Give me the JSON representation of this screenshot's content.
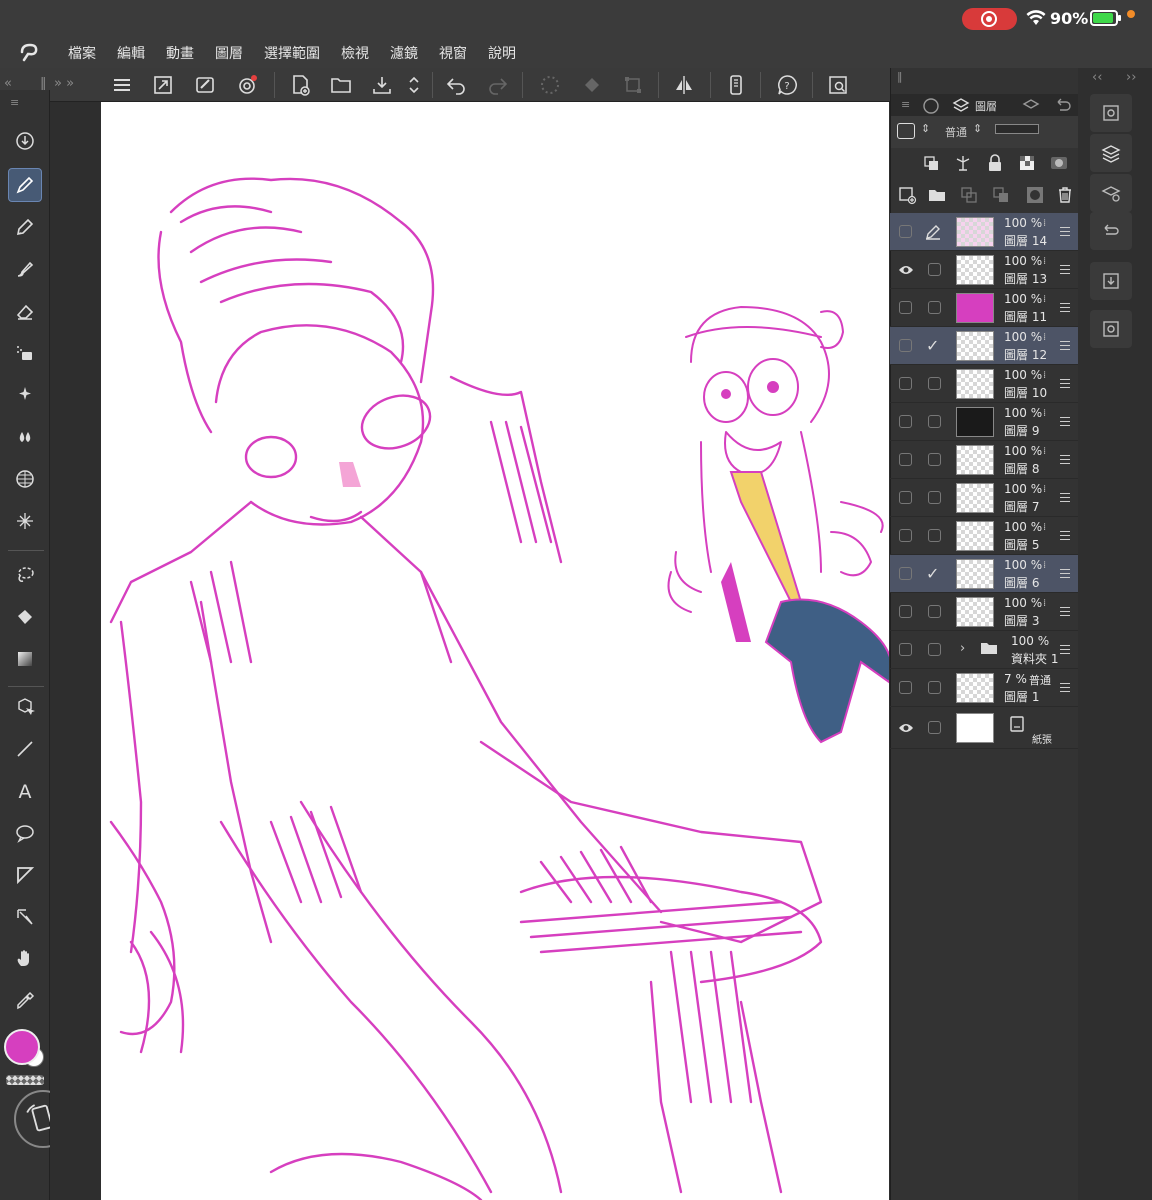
{
  "status": {
    "battery_percent": "90%",
    "colors": {
      "record": "#d83a3a",
      "battery": "#3fd84a",
      "notify": "#f28c28"
    }
  },
  "menu": [
    "檔案",
    "編輯",
    "動畫",
    "圖層",
    "選擇範圍",
    "檢視",
    "濾鏡",
    "視窗",
    "說明"
  ],
  "layers_panel": {
    "tab_label": "圖層",
    "blend_mode": "普通",
    "layers": [
      {
        "opacity": "100 %",
        "name": "圖層 14",
        "selected": true,
        "thumb": "pattern"
      },
      {
        "opacity": "100 %",
        "name": "圖層 13",
        "visible": true,
        "thumb": "pattern"
      },
      {
        "opacity": "100 %",
        "name": "圖層 11",
        "thumb": "magenta"
      },
      {
        "opacity": "100 %",
        "name": "圖層 12",
        "selected": true,
        "checked": true,
        "thumb": "pattern"
      },
      {
        "opacity": "100 %",
        "name": "圖層 10",
        "thumb": "pattern"
      },
      {
        "opacity": "100 %",
        "name": "圖層 9",
        "thumb": "dark"
      },
      {
        "opacity": "100 %",
        "name": "圖層 8",
        "thumb": "pattern"
      },
      {
        "opacity": "100 %",
        "name": "圖層 7",
        "thumb": "pattern"
      },
      {
        "opacity": "100 %",
        "name": "圖層 5",
        "thumb": "pattern"
      },
      {
        "opacity": "100 %",
        "name": "圖層 6",
        "selected": true,
        "checked": true,
        "thumb": "pattern"
      },
      {
        "opacity": "100 %",
        "name": "圖層 3",
        "thumb": "pattern"
      },
      {
        "opacity": "100 %",
        "name": "資料夾 1",
        "folder": true
      },
      {
        "opacity": "7 %",
        "mode": "普通",
        "name": "圖層 1",
        "thumb": "pattern"
      },
      {
        "name": "紙張",
        "paper": true,
        "visible": true,
        "thumb": "plain"
      }
    ]
  },
  "current_color": "#d63fbf",
  "canvas": {
    "stroke_color": "#d63fbf",
    "vest_color": "#f2d26b",
    "pants_color": "#3f5f85",
    "nose_color": "#f4a5d6"
  }
}
